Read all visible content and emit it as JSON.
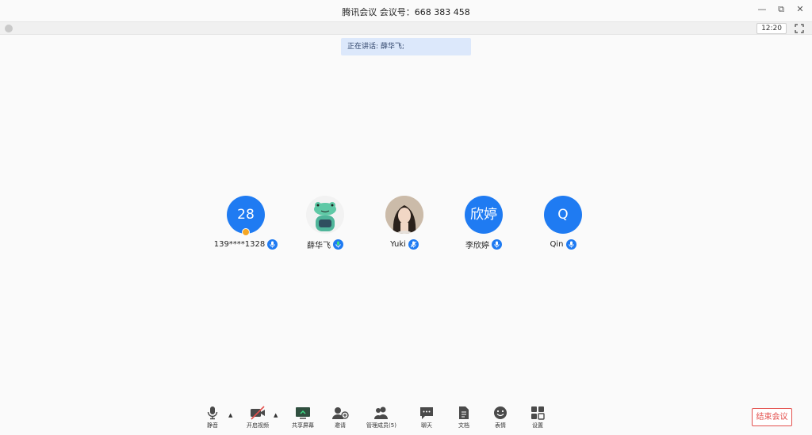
{
  "window": {
    "title": "腾讯会议 会议号：668 383 458",
    "minimize": "—",
    "restore": "⧉",
    "close": "✕"
  },
  "infobar": {
    "time": "12:20"
  },
  "speaking_banner": "正在讲话: 薛华飞;",
  "participants": [
    {
      "avatar_text": "28",
      "name": "139****1328",
      "avatar_type": "blue",
      "host": true
    },
    {
      "avatar_text": "",
      "name": "薛华飞",
      "avatar_type": "frog-icon"
    },
    {
      "avatar_text": "",
      "name": "Yuki",
      "avatar_type": "photo"
    },
    {
      "avatar_text": "欣婷",
      "name": "李欣婷",
      "avatar_type": "blue"
    },
    {
      "avatar_text": "Q",
      "name": "Qin",
      "avatar_type": "blue"
    }
  ],
  "toolbar": {
    "mute": "静音",
    "video": "开启视频",
    "share": "共享屏幕",
    "invite": "邀请",
    "members": "管理成员(5)",
    "chat": "聊天",
    "docs": "文档",
    "emoji": "表情",
    "settings": "设置",
    "caret": "▲"
  },
  "end_meeting": "结束会议",
  "colors": {
    "accent": "#1f7bf2",
    "danger": "#e3504d",
    "banner": "#dce8fb"
  }
}
